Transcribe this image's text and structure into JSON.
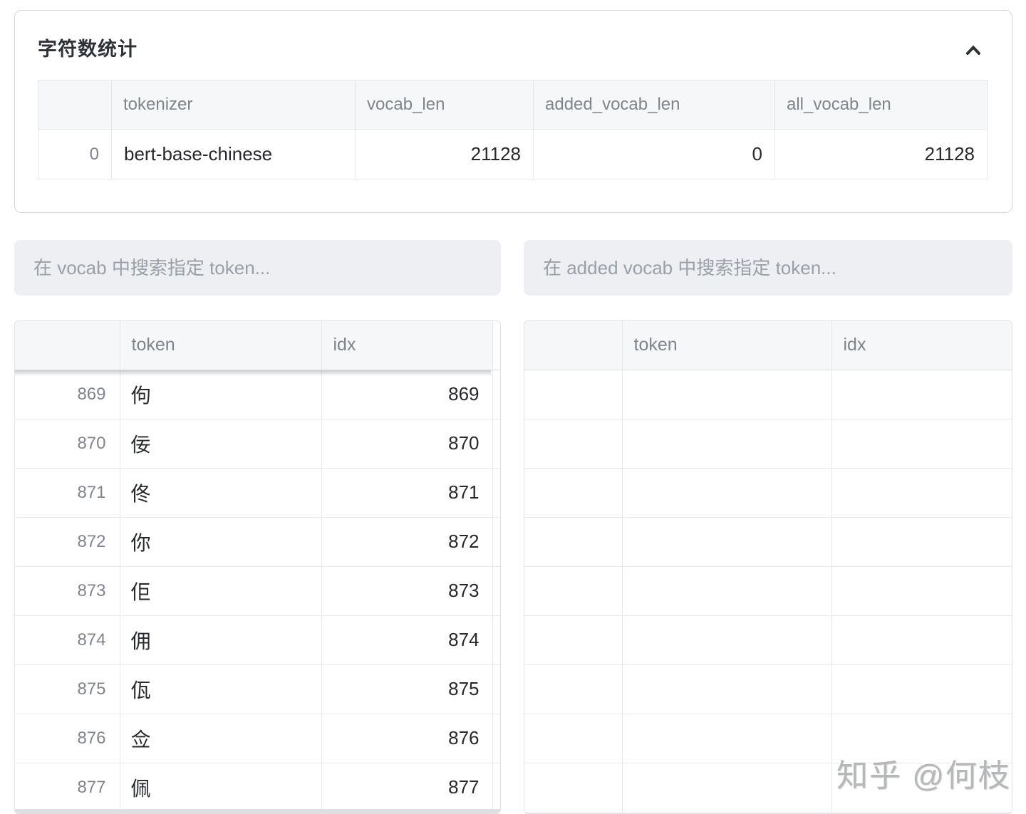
{
  "stats_panel": {
    "title": "字符数统计",
    "collapse_icon": "chevron-up-icon",
    "table": {
      "columns": [
        "",
        "tokenizer",
        "vocab_len",
        "added_vocab_len",
        "all_vocab_len"
      ],
      "rows": [
        {
          "index": "0",
          "tokenizer": "bert-base-chinese",
          "vocab_len": "21128",
          "added_vocab_len": "0",
          "all_vocab_len": "21128"
        }
      ]
    }
  },
  "vocab_section": {
    "search_placeholder": "在 vocab 中搜索指定 token...",
    "table": {
      "columns": [
        "",
        "token",
        "idx"
      ],
      "rows": [
        {
          "index": "869",
          "token": "佝",
          "idx": "869"
        },
        {
          "index": "870",
          "token": "佞",
          "idx": "870"
        },
        {
          "index": "871",
          "token": "佟",
          "idx": "871"
        },
        {
          "index": "872",
          "token": "你",
          "idx": "872"
        },
        {
          "index": "873",
          "token": "佢",
          "idx": "873"
        },
        {
          "index": "874",
          "token": "佣",
          "idx": "874"
        },
        {
          "index": "875",
          "token": "佤",
          "idx": "875"
        },
        {
          "index": "876",
          "token": "佥",
          "idx": "876"
        },
        {
          "index": "877",
          "token": "佩",
          "idx": "877"
        }
      ]
    }
  },
  "added_vocab_section": {
    "search_placeholder": "在 added vocab 中搜索指定 token...",
    "table": {
      "columns": [
        "",
        "token",
        "idx"
      ],
      "rows": [],
      "empty_row_count": 9
    }
  },
  "watermark": "知乎 @何枝",
  "colors": {
    "table_header_bg": "#f6f7f9",
    "search_bg": "#edeff2",
    "border": "#e0e2e5",
    "header_text": "#7f848d",
    "body_text": "#26282d",
    "index_text": "#80848e",
    "title_text": "#2e3138"
  }
}
